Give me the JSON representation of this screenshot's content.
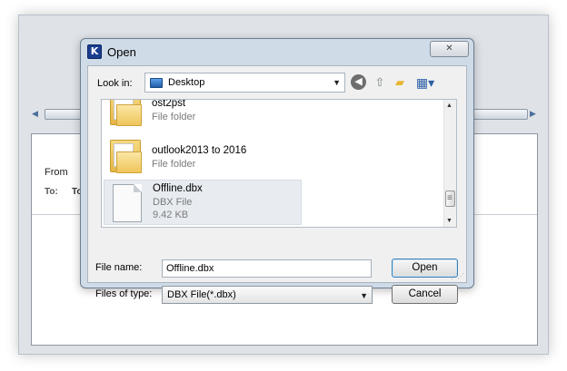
{
  "background_window": {
    "from_label": "From",
    "to_label": "To:",
    "to_value": "To"
  },
  "dialog": {
    "title": "Open",
    "app_icon_letter": "K",
    "close_symbol": "✕",
    "look_in_label": "Look in:",
    "look_in_value": "Desktop",
    "files": [
      {
        "name": "ost2pst",
        "type": "File folder",
        "size": "",
        "icon": "folder-icon"
      },
      {
        "name": "outlook2013 to 2016",
        "type": "File folder",
        "size": "",
        "icon": "folder-icon"
      },
      {
        "name": "Offline.dbx",
        "type": "DBX File",
        "size": "9.42 KB",
        "icon": "file-icon",
        "selected": true
      }
    ],
    "file_name_label": "File name:",
    "file_name_value": "Offline.dbx",
    "files_of_type_label": "Files of type:",
    "files_of_type_value": "DBX File(*.dbx)",
    "open_button": "Open",
    "cancel_button": "Cancel"
  },
  "icons": {
    "back": "back-arrow-icon",
    "up": "up-folder-icon",
    "new_folder": "new-folder-icon",
    "views": "view-menu-icon"
  },
  "colors": {
    "dialog_frame": "#cfdbe7",
    "selection": "#e8ecf1"
  }
}
